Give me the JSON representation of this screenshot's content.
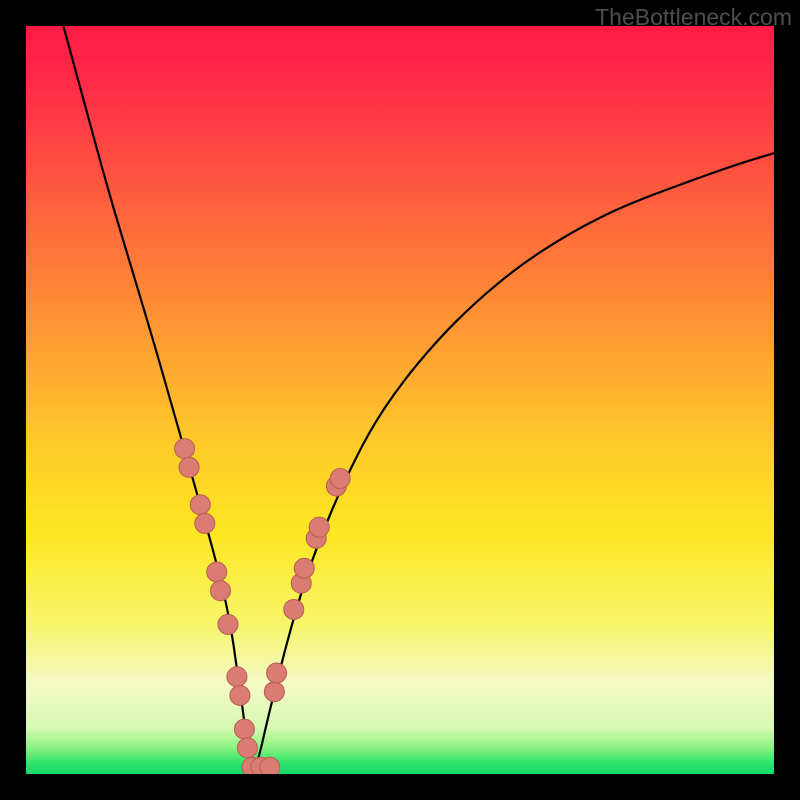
{
  "watermark": "TheBottleneck.com",
  "chart_data": {
    "type": "line",
    "title": "",
    "xlabel": "",
    "ylabel": "",
    "xlim": [
      0,
      100
    ],
    "ylim": [
      0,
      100
    ],
    "background_gradient": {
      "stops": [
        {
          "offset": 0.0,
          "color": "#ff1a47"
        },
        {
          "offset": 0.09,
          "color": "#ff2f47"
        },
        {
          "offset": 0.22,
          "color": "#ff5a3f"
        },
        {
          "offset": 0.38,
          "color": "#ff8f35"
        },
        {
          "offset": 0.55,
          "color": "#ffc82a"
        },
        {
          "offset": 0.68,
          "color": "#fde722"
        },
        {
          "offset": 0.8,
          "color": "#f7f66a"
        },
        {
          "offset": 0.88,
          "color": "#f4f9c6"
        },
        {
          "offset": 0.938,
          "color": "#d8fbb2"
        },
        {
          "offset": 0.965,
          "color": "#8af280"
        },
        {
          "offset": 0.985,
          "color": "#2fe36b"
        },
        {
          "offset": 1.0,
          "color": "#17d76a"
        }
      ]
    },
    "series": [
      {
        "name": "bottleneck-curve",
        "stroke": "#000000",
        "x": [
          5,
          8,
          11,
          14,
          17,
          19,
          21,
          23,
          25,
          26.5,
          27.5,
          28.2,
          28.8,
          29.3,
          29.7,
          30.0,
          30.5,
          31.2,
          32.0,
          33.2,
          35.0,
          37.0,
          39.5,
          42.5,
          46.0,
          50.0,
          55.0,
          60.0,
          66.0,
          73.0,
          80.0,
          88.0,
          95.0,
          100.0
        ],
        "y": [
          100,
          89,
          78,
          68,
          58,
          51,
          44,
          37,
          30,
          24,
          19,
          14,
          10,
          6,
          3,
          0.8,
          0.6,
          2.5,
          6,
          11,
          18,
          25,
          32,
          39,
          46,
          52,
          58,
          63,
          68,
          72.5,
          76,
          79,
          81.5,
          83
        ]
      }
    ],
    "markers": {
      "name": "highlighted-points",
      "fill": "#da7c73",
      "stroke": "#b55d55",
      "radius_px": 10,
      "points": [
        {
          "x": 21.2,
          "y": 43.5
        },
        {
          "x": 21.8,
          "y": 41.0
        },
        {
          "x": 23.3,
          "y": 36.0
        },
        {
          "x": 23.9,
          "y": 33.5
        },
        {
          "x": 25.5,
          "y": 27.0
        },
        {
          "x": 26.0,
          "y": 24.5
        },
        {
          "x": 27.0,
          "y": 20.0
        },
        {
          "x": 28.2,
          "y": 13.0
        },
        {
          "x": 28.6,
          "y": 10.5
        },
        {
          "x": 29.2,
          "y": 6.0
        },
        {
          "x": 29.6,
          "y": 3.5
        },
        {
          "x": 30.2,
          "y": 0.9
        },
        {
          "x": 31.4,
          "y": 0.9
        },
        {
          "x": 32.6,
          "y": 0.9
        },
        {
          "x": 33.2,
          "y": 11.0
        },
        {
          "x": 33.5,
          "y": 13.5
        },
        {
          "x": 35.8,
          "y": 22.0
        },
        {
          "x": 36.8,
          "y": 25.5
        },
        {
          "x": 37.2,
          "y": 27.5
        },
        {
          "x": 38.8,
          "y": 31.5
        },
        {
          "x": 39.2,
          "y": 33.0
        },
        {
          "x": 41.5,
          "y": 38.5
        },
        {
          "x": 42.0,
          "y": 39.5
        }
      ]
    }
  }
}
